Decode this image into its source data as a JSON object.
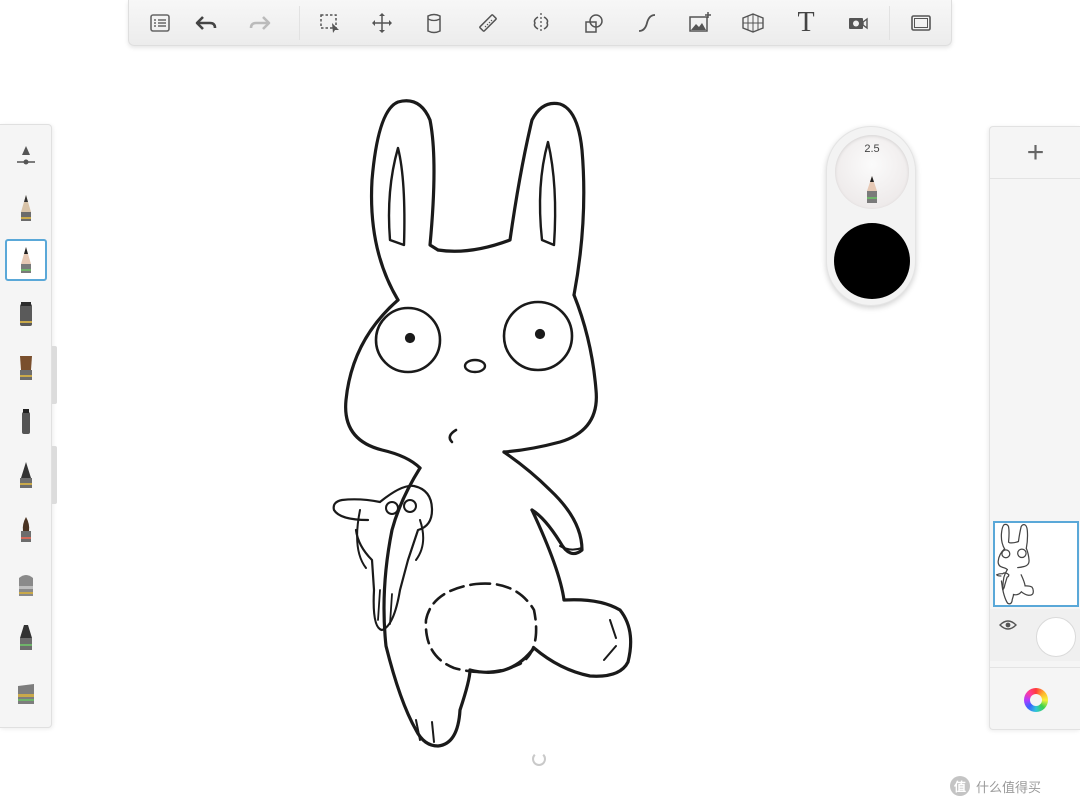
{
  "toolbar": {
    "tools": [
      {
        "name": "menu-icon"
      },
      {
        "name": "undo-icon"
      },
      {
        "name": "redo-icon"
      },
      {
        "name": "selection-icon"
      },
      {
        "name": "transform-icon"
      },
      {
        "name": "fill-icon"
      },
      {
        "name": "ruler-icon"
      },
      {
        "name": "symmetry-icon"
      },
      {
        "name": "shapes-icon"
      },
      {
        "name": "curve-icon"
      },
      {
        "name": "add-image-icon"
      },
      {
        "name": "perspective-icon"
      },
      {
        "name": "text-icon",
        "glyph": "T"
      },
      {
        "name": "time-lapse-icon"
      },
      {
        "name": "fullscreen-icon"
      }
    ]
  },
  "brushes": [
    {
      "name": "brush-slider",
      "selected": false
    },
    {
      "name": "brush-pencil",
      "selected": false
    },
    {
      "name": "brush-pencil-soft",
      "selected": true
    },
    {
      "name": "brush-marker",
      "selected": false
    },
    {
      "name": "brush-paint",
      "selected": false
    },
    {
      "name": "brush-felt",
      "selected": false
    },
    {
      "name": "brush-ink",
      "selected": false
    },
    {
      "name": "brush-round",
      "selected": false
    },
    {
      "name": "brush-eraser",
      "selected": false
    },
    {
      "name": "brush-airbrush",
      "selected": false
    },
    {
      "name": "brush-smudge",
      "selected": false
    }
  ],
  "puck": {
    "brush_size": "2.5",
    "color": "#000000"
  },
  "layers": {
    "add_label": "+",
    "background_color": "#ffffff"
  },
  "accent_color": "#5aa8d8",
  "watermark": {
    "badge": "值",
    "text": "什么值得买"
  }
}
